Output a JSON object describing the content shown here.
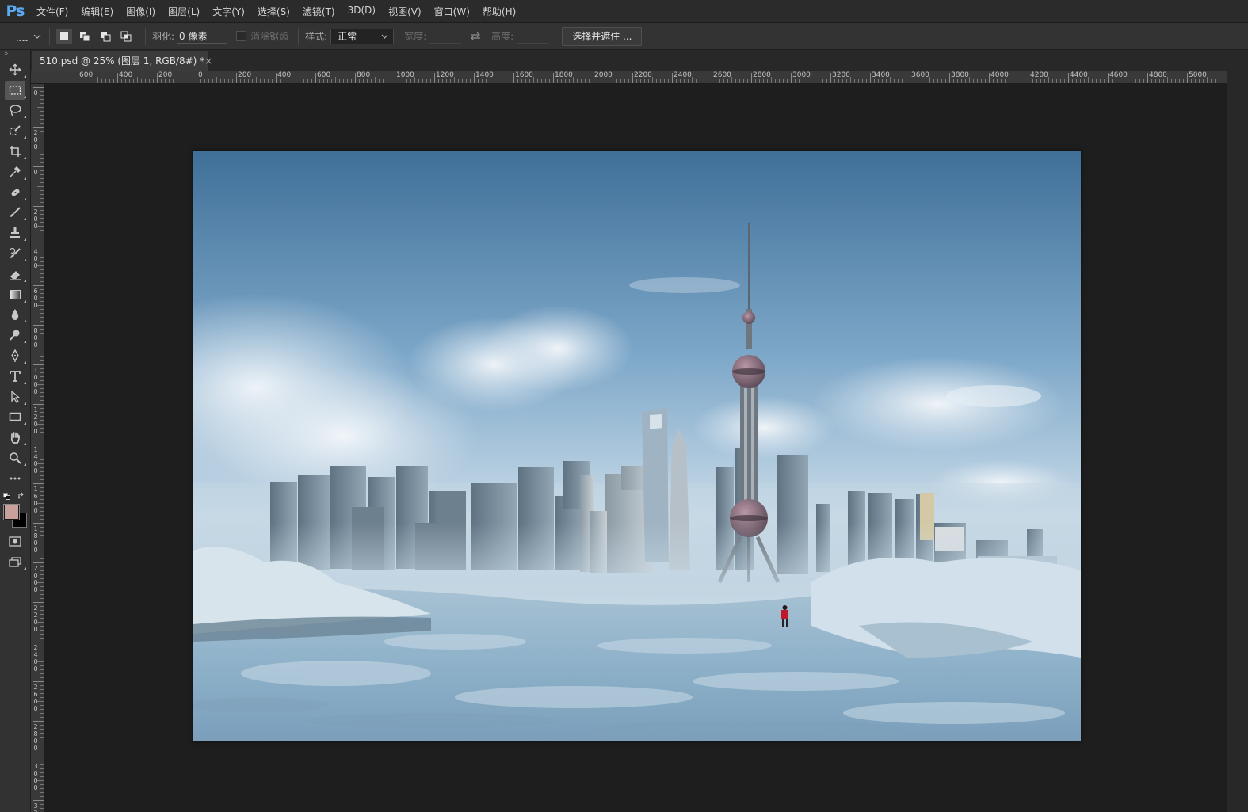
{
  "app": {
    "logo": "Ps"
  },
  "menu": [
    {
      "id": "file",
      "label": "文件(F)"
    },
    {
      "id": "edit",
      "label": "编辑(E)"
    },
    {
      "id": "image",
      "label": "图像(I)"
    },
    {
      "id": "layer",
      "label": "图层(L)"
    },
    {
      "id": "type",
      "label": "文字(Y)"
    },
    {
      "id": "select",
      "label": "选择(S)"
    },
    {
      "id": "filter",
      "label": "滤镜(T)"
    },
    {
      "id": "3d",
      "label": "3D(D)"
    },
    {
      "id": "view",
      "label": "视图(V)"
    },
    {
      "id": "window",
      "label": "窗口(W)"
    },
    {
      "id": "help",
      "label": "帮助(H)"
    }
  ],
  "options": {
    "feather_label": "羽化:",
    "feather_value": "0 像素",
    "antialias_label": "消除锯齿",
    "style_label": "样式:",
    "style_value": "正常",
    "width_label": "宽度:",
    "height_label": "高度:",
    "select_mask_button": "选择并遮住 ..."
  },
  "document": {
    "tab_title": "510.psd @ 25% (图层 1, RGB/8#) *",
    "close_glyph": "×"
  },
  "rulers": {
    "top_labels": [
      "600",
      "400",
      "200",
      "0",
      "200",
      "400",
      "600",
      "800",
      "1000",
      "1200",
      "1400",
      "1600",
      "1800",
      "2000",
      "2200",
      "2400",
      "2600",
      "2800",
      "3000",
      "3200",
      "3400",
      "3600",
      "3800",
      "4000",
      "4200",
      "4400",
      "4600",
      "4800",
      "5000",
      "52"
    ],
    "left_labels": [
      "0",
      "200",
      "0",
      "200",
      "400",
      "600",
      "800",
      "1000",
      "1200",
      "1400",
      "1600",
      "1800",
      "2000",
      "2200",
      "2400",
      "2600",
      "2800",
      "3000",
      "32"
    ]
  },
  "toolbar": {
    "tools": [
      {
        "name": "move-tool-icon",
        "icon": "move"
      },
      {
        "name": "rectangular-marquee-tool-icon",
        "icon": "marquee",
        "active": true
      },
      {
        "name": "lasso-tool-icon",
        "icon": "lasso"
      },
      {
        "name": "quick-selection-tool-icon",
        "icon": "quicksel"
      },
      {
        "name": "crop-tool-icon",
        "icon": "crop"
      },
      {
        "name": "eyedropper-tool-icon",
        "icon": "eyedropper"
      },
      {
        "name": "healing-brush-tool-icon",
        "icon": "bandage"
      },
      {
        "name": "brush-tool-icon",
        "icon": "brush"
      },
      {
        "name": "clone-stamp-tool-icon",
        "icon": "stamp"
      },
      {
        "name": "history-brush-tool-icon",
        "icon": "historybrush"
      },
      {
        "name": "eraser-tool-icon",
        "icon": "eraser"
      },
      {
        "name": "gradient-tool-icon",
        "icon": "gradient"
      },
      {
        "name": "blur-tool-icon",
        "icon": "drop"
      },
      {
        "name": "dodge-tool-icon",
        "icon": "dodge"
      },
      {
        "name": "pen-tool-icon",
        "icon": "pen"
      },
      {
        "name": "type-tool-icon",
        "icon": "type"
      },
      {
        "name": "path-selection-tool-icon",
        "icon": "arrow"
      },
      {
        "name": "rectangle-tool-icon",
        "icon": "rect"
      },
      {
        "name": "hand-tool-icon",
        "icon": "hand"
      },
      {
        "name": "zoom-tool-icon",
        "icon": "zoom"
      },
      {
        "name": "edit-toolbar-icon",
        "icon": "dots"
      }
    ],
    "foreground_color": "#c9a09c",
    "background_color": "#000000"
  },
  "colors": {
    "accent": "#5aa9f2",
    "canvas_bg": "#1e1e1e",
    "panel_bg": "#323232"
  }
}
